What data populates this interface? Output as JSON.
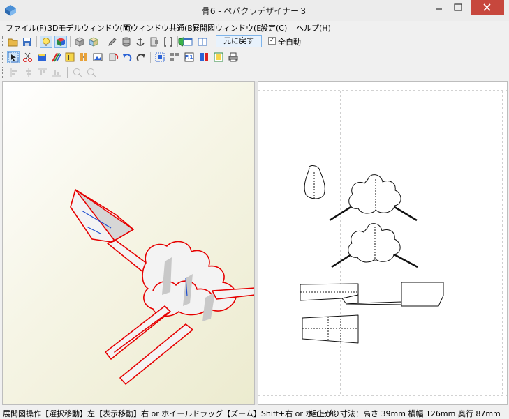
{
  "window": {
    "title": "骨6 - ペパクラデザイナー３",
    "minimize": "−",
    "maximize": "☐",
    "close": "✕"
  },
  "menu": [
    {
      "label": "ファイル(F)"
    },
    {
      "label": "3Dモデルウィンドウ(M)"
    },
    {
      "label": "両ウィンドウ共通(B)"
    },
    {
      "label": "展開図ウィンドウ(E)"
    },
    {
      "label": "設定(C)"
    },
    {
      "label": "ヘルプ(H)"
    }
  ],
  "toolbar": {
    "undo_label": "元に戻す",
    "auto_label": "全自動",
    "auto_checked": "✓",
    "tb2_print_label": "P.1"
  },
  "icons": {
    "open": "folder-open-icon",
    "save": "save-disk-icon",
    "light": "light-bulb-icon",
    "texture": "texture-cube-icon",
    "undo_arrow": "undo-arrow-icon",
    "redo_arrow": "redo-arrow-icon"
  },
  "colors": {
    "model_edge": "#e60000",
    "model_crease": "#2050d0",
    "fold_line": "#111111",
    "guide_line": "#888888",
    "active_button": "#cde4f7",
    "close_button": "#c7473d"
  },
  "status": {
    "left": "展開図操作【選択移動】左【表示移動】右 or ホイールドラッグ【ズーム】Shift+右 or ホイール",
    "right": "組上がり寸法：高さ 39mm 横幅 126mm 奥行 87mm"
  }
}
